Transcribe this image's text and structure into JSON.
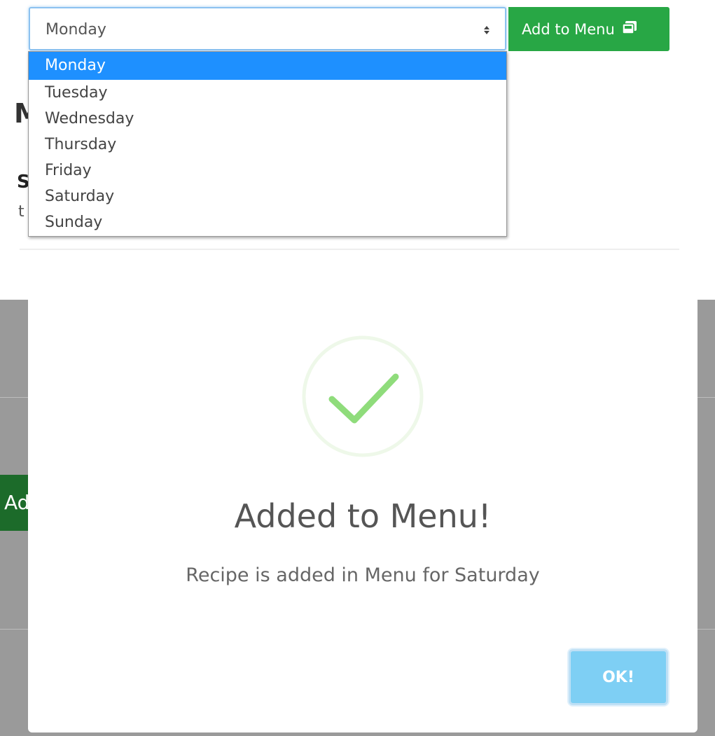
{
  "select": {
    "value": "Monday",
    "options": [
      "Monday",
      "Tuesday",
      "Wednesday",
      "Thursday",
      "Friday",
      "Saturday",
      "Sunday"
    ],
    "highlighted_option": "Monday"
  },
  "add_button": {
    "label": "Add to Menu",
    "icon": "save-icon",
    "color": "#28a745"
  },
  "background": {
    "heading_fragment": "M",
    "sub_fragment_1": "S",
    "sub_fragment_2": "t",
    "green_button_fragment": "Add"
  },
  "modal": {
    "icon": "success-check-icon",
    "title": "Added to Menu!",
    "text": "Recipe is added in Menu for Saturday",
    "ok_label": "OK!",
    "ok_color": "#7ecff4",
    "check_color": "#8fdc7b"
  }
}
